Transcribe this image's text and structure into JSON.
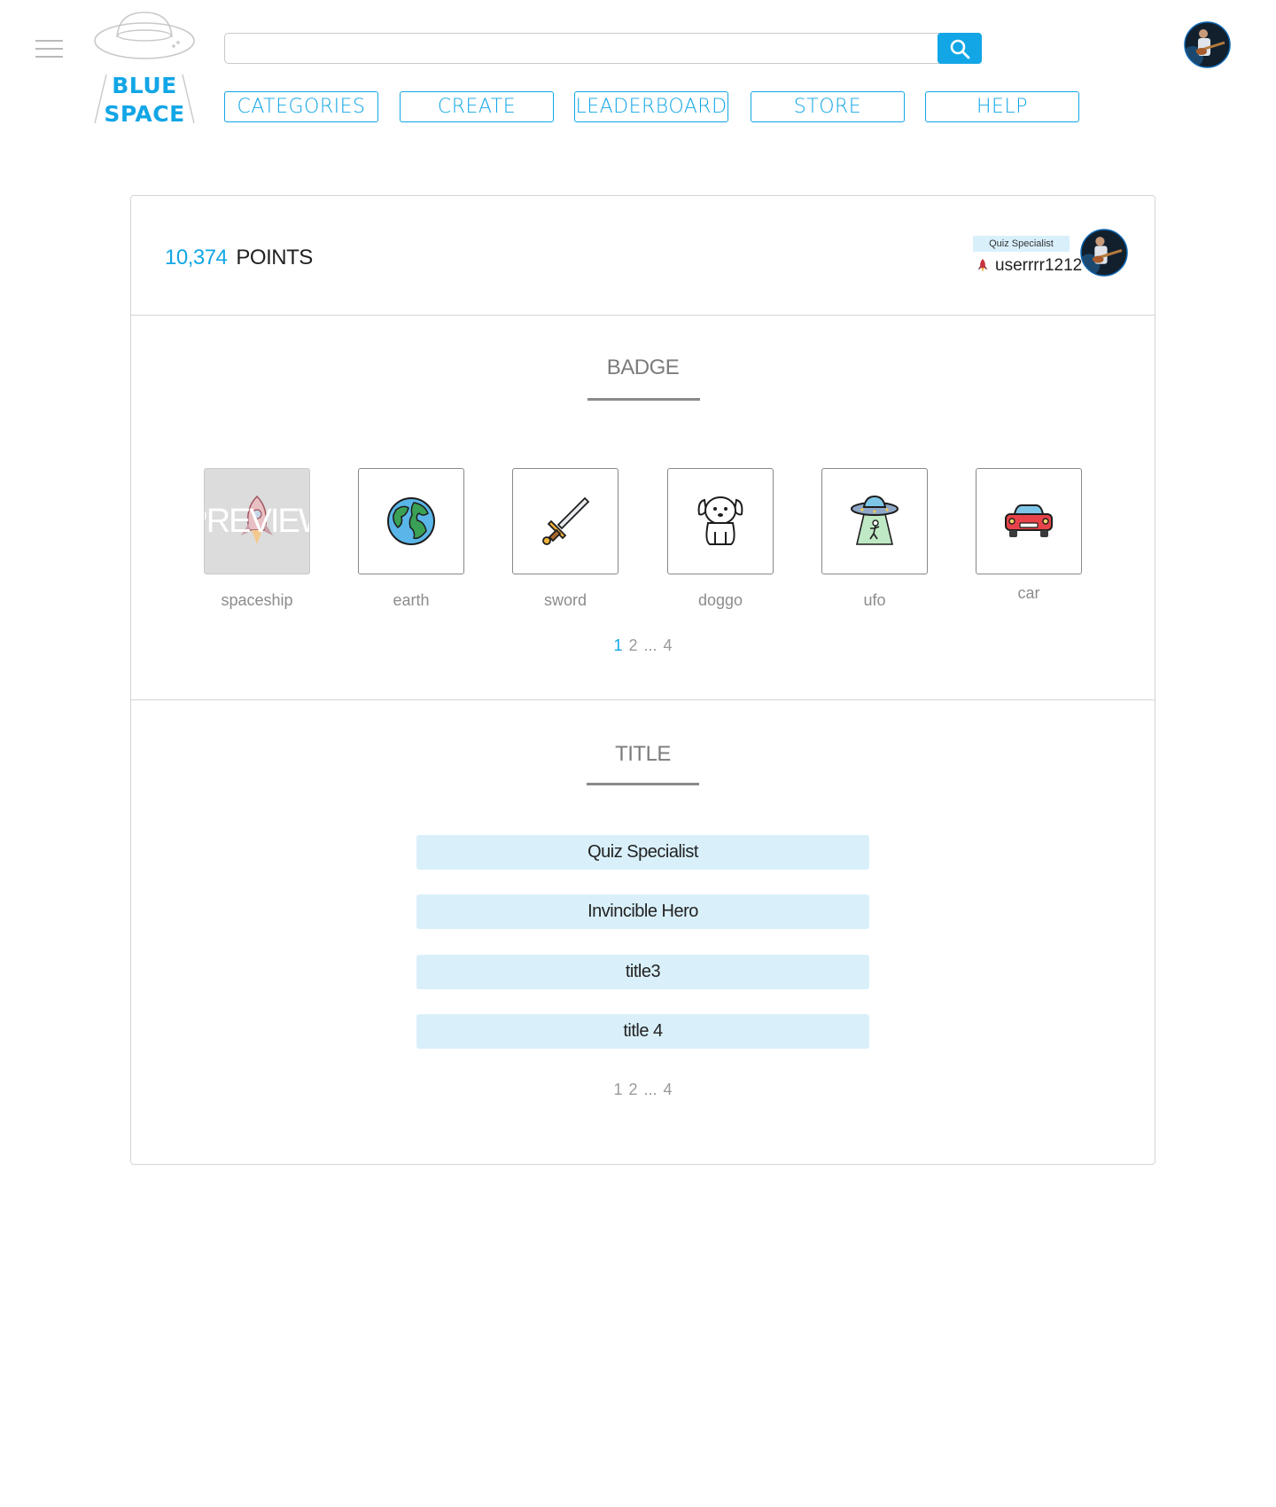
{
  "header": {
    "logo": {
      "line1": "BLUE",
      "line2": "SPACE"
    },
    "search": {
      "value": "",
      "placeholder": ""
    },
    "nav": [
      "CATEGORIES",
      "CREATE",
      "LEADERBOARD",
      "STORE",
      "HELP"
    ]
  },
  "profile": {
    "points_value": "10,374",
    "points_label": "POINTS",
    "current_title": "Quiz Specialist",
    "username": "userrrr1212"
  },
  "badge_section": {
    "heading": "BADGE",
    "preview_label": "PREVIEW",
    "items": [
      {
        "label": "spaceship",
        "icon": "rocket-icon",
        "selected": true
      },
      {
        "label": "earth",
        "icon": "earth-icon",
        "selected": false
      },
      {
        "label": "sword",
        "icon": "sword-icon",
        "selected": false
      },
      {
        "label": "doggo",
        "icon": "dog-icon",
        "selected": false
      },
      {
        "label": "ufo",
        "icon": "ufo-icon",
        "selected": false
      },
      {
        "label": "car",
        "icon": "car-icon",
        "selected": false
      }
    ],
    "pagination": {
      "p1": "1",
      "p2": "2",
      "ellipsis": "...",
      "last": "4",
      "current": "1"
    }
  },
  "title_section": {
    "heading": "TITLE",
    "items": [
      "Quiz Specialist",
      "Invincible Hero",
      "title3",
      "title 4"
    ],
    "pagination": {
      "p1": "1",
      "p2": "2",
      "ellipsis": "...",
      "last": "4"
    }
  },
  "colors": {
    "accent": "#12a6e6",
    "title_bg": "#d9f0fb",
    "muted": "#8c8c8c"
  }
}
